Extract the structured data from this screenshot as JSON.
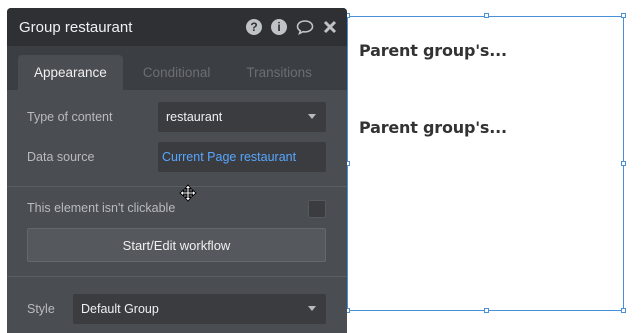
{
  "panel": {
    "title": "Group restaurant",
    "tabs": [
      {
        "label": "Appearance",
        "active": true
      },
      {
        "label": "Conditional",
        "active": false
      },
      {
        "label": "Transitions",
        "active": false
      }
    ],
    "header_icons": {
      "help": "?",
      "info": "i"
    },
    "type_of_content": {
      "label": "Type of content",
      "value": "restaurant"
    },
    "data_source": {
      "label": "Data source",
      "value": "Current Page restaurant"
    },
    "clickable": {
      "label": "This element isn't clickable",
      "checked": false
    },
    "workflow_button": "Start/Edit workflow",
    "style": {
      "label": "Style",
      "value": "Default Group"
    }
  },
  "canvas": {
    "texts": [
      "Parent group's...",
      "Parent group's..."
    ]
  },
  "colors": {
    "selection": "#4a90d9",
    "link": "#58a6ff",
    "panel_bg": "#4a4d52"
  }
}
